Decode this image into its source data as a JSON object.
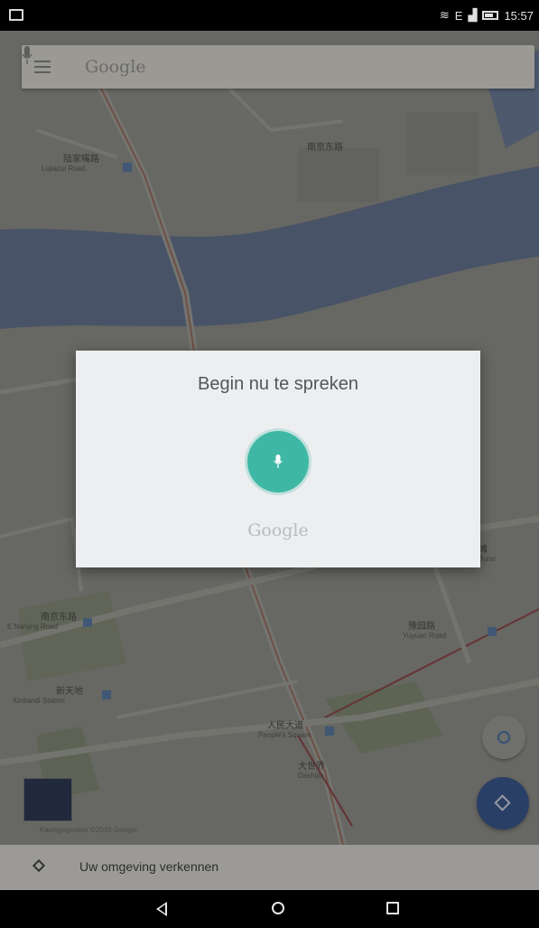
{
  "status_bar": {
    "network": "E",
    "time": "15:57"
  },
  "search": {
    "placeholder": "Google"
  },
  "map": {
    "labels": [
      {
        "text": "陆家嘴路",
        "sub": "Lujiazui Road"
      },
      {
        "text": "南京东路",
        "sub": "E Nanjing Road"
      },
      {
        "text": "新天地",
        "sub": "Xintiandi Station"
      },
      {
        "text": "人民大道",
        "sub": "People's Square"
      },
      {
        "text": "豫园路",
        "sub": "Yuyuan Road"
      },
      {
        "text": "大世界",
        "sub": "Dashijie"
      },
      {
        "text": "南京东路",
        "sub": ""
      },
      {
        "text": "外滩",
        "sub": "The Bund"
      }
    ],
    "legal": "Kaartgegevens ©2016 Google"
  },
  "voice_dialog": {
    "title": "Begin nu te spreken",
    "brand": "Google"
  },
  "explore": {
    "label": "Uw omgeving verkennen"
  },
  "icons": {
    "menu": "menu-icon",
    "mic": "microphone-icon",
    "location": "my-location-icon",
    "directions": "directions-icon",
    "explore": "explore-icon",
    "back": "back-icon",
    "home": "home-icon",
    "recents": "recents-icon"
  },
  "colors": {
    "mic_accent": "#3eb8a4",
    "directions_fab": "#2d4e8c"
  }
}
